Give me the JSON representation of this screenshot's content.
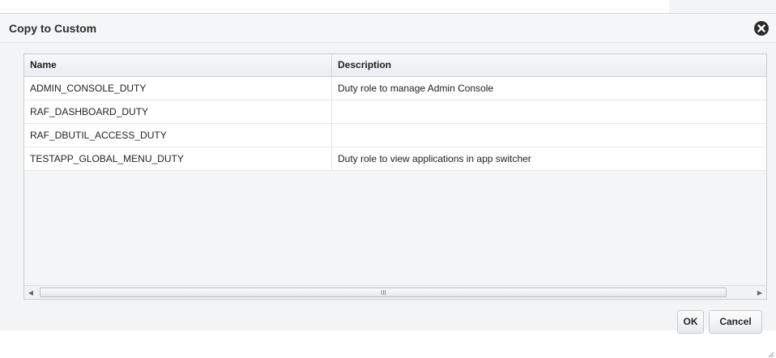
{
  "dialog": {
    "title": "Copy to Custom",
    "close_icon": "close-circle-icon"
  },
  "table": {
    "columns": [
      "Name",
      "Description"
    ],
    "rows": [
      {
        "name": "ADMIN_CONSOLE_DUTY",
        "description": "Duty role to manage Admin Console"
      },
      {
        "name": "RAF_DASHBOARD_DUTY",
        "description": ""
      },
      {
        "name": "RAF_DBUTIL_ACCESS_DUTY",
        "description": ""
      },
      {
        "name": "TESTAPP_GLOBAL_MENU_DUTY",
        "description": "Duty role to view applications in app switcher"
      }
    ],
    "scrollbar": {
      "left_icon": "scroll-left-icon",
      "right_icon": "scroll-right-icon",
      "grip": "III"
    }
  },
  "buttons": {
    "ok_label": "OK",
    "cancel_label": "Cancel"
  },
  "colors": {
    "dialog_bg": "#f3f4f6",
    "row_bg": "#ffffff",
    "close_bg": "#2b2b2b"
  }
}
